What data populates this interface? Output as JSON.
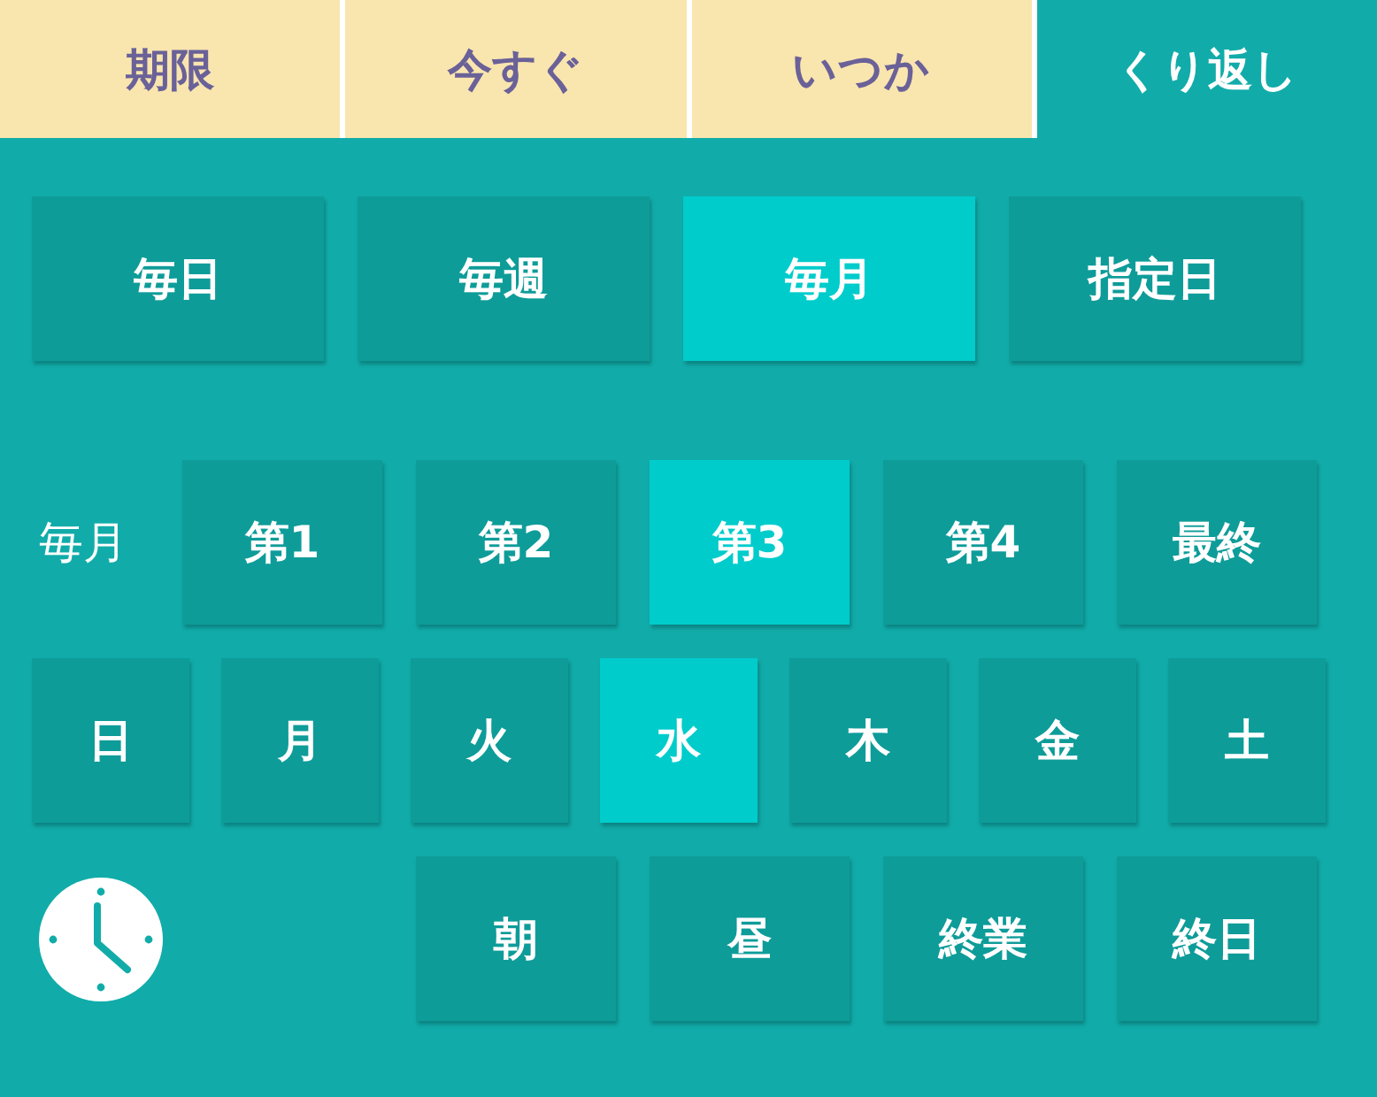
{
  "tabs": [
    {
      "label": "期限",
      "selected": false
    },
    {
      "label": "今すぐ",
      "selected": false
    },
    {
      "label": "いつか",
      "selected": false
    },
    {
      "label": "くり返し",
      "selected": true
    }
  ],
  "frequency": [
    {
      "label": "毎日",
      "selected": false
    },
    {
      "label": "毎週",
      "selected": false
    },
    {
      "label": "毎月",
      "selected": true
    },
    {
      "label": "指定日",
      "selected": false
    }
  ],
  "week_of_month": {
    "label": "毎月",
    "options": [
      {
        "label": "第1",
        "selected": false
      },
      {
        "label": "第2",
        "selected": false
      },
      {
        "label": "第3",
        "selected": true
      },
      {
        "label": "第4",
        "selected": false
      },
      {
        "label": "最終",
        "selected": false
      }
    ]
  },
  "weekdays": [
    {
      "label": "日",
      "selected": false
    },
    {
      "label": "月",
      "selected": false
    },
    {
      "label": "火",
      "selected": false
    },
    {
      "label": "水",
      "selected": true
    },
    {
      "label": "木",
      "selected": false
    },
    {
      "label": "金",
      "selected": false
    },
    {
      "label": "土",
      "selected": false
    }
  ],
  "times": [
    {
      "label": "朝",
      "selected": false
    },
    {
      "label": "昼",
      "selected": false
    },
    {
      "label": "終業",
      "selected": false
    },
    {
      "label": "終日",
      "selected": false
    }
  ]
}
